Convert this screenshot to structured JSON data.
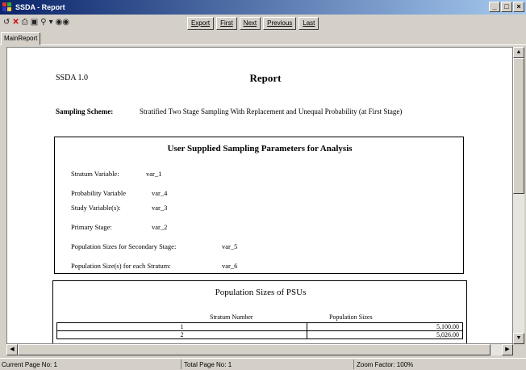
{
  "window": {
    "title": "SSDA - Report",
    "controls": {
      "minimize": "_",
      "restore": "□",
      "close": "×"
    }
  },
  "toolbar": {
    "icons": [
      "refresh-icon",
      "close-icon",
      "print-icon",
      "page-setup-icon",
      "zoom-icon",
      "dropdown-icon",
      "binoculars-icon"
    ],
    "buttons": [
      "Export",
      "First",
      "Next",
      "Previous",
      "Last"
    ]
  },
  "tabs": [
    "MainReport"
  ],
  "report": {
    "version": "SSDA 1.0",
    "title": "Report",
    "scheme_label": "Sampling Scheme:",
    "scheme_value": "Stratified Two Stage Sampling With Replacement and Unequal Probability (at First Stage)",
    "params_title": "User Supplied Sampling Parameters for Analysis",
    "params": [
      {
        "label": "Stratum Variable:",
        "value": "var_1"
      },
      {
        "label": "Probability Variable",
        "value": "var_4"
      },
      {
        "label": "Study Variable(s):",
        "value": "var_3"
      },
      {
        "label": "Primary Stage:",
        "value": "var_2"
      },
      {
        "label": "Population Sizes for Secondary Stage:",
        "value": "var_5"
      },
      {
        "label": "Population Size(s) for each Stratum:",
        "value": "var_6"
      }
    ],
    "psu": {
      "title": "Population Sizes of PSUs",
      "columns": [
        "Stratum Number",
        "Population Sizes"
      ],
      "rows": [
        [
          "1",
          "5,100.00"
        ],
        [
          "2",
          "5,026.00"
        ]
      ]
    }
  },
  "status": {
    "current_page": "Current Page No: 1",
    "total_page": "Total Page No: 1",
    "zoom": "Zoom Factor: 100%"
  }
}
